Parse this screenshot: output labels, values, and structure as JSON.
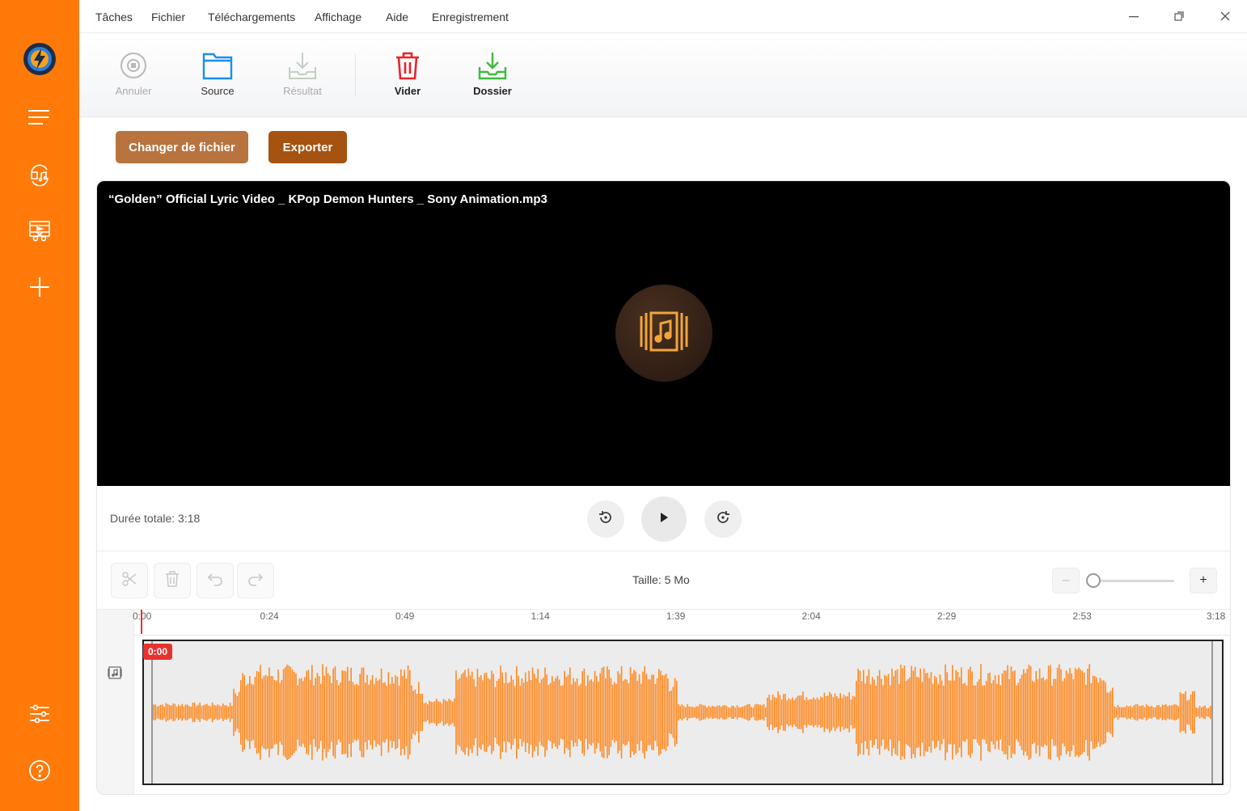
{
  "colors": {
    "accent": "#ff7a09",
    "change_button": "#b8733e",
    "export_button": "#a65210",
    "waveform": "#ff8a22",
    "playhead": "#e8322d"
  },
  "sidebar": {
    "items": [
      {
        "icon": "app-logo-icon"
      },
      {
        "icon": "menu-icon"
      },
      {
        "icon": "audio-convert-icon"
      },
      {
        "icon": "video-cut-icon"
      },
      {
        "icon": "add-icon"
      },
      {
        "icon": "settings-sliders-icon"
      },
      {
        "icon": "help-icon"
      }
    ]
  },
  "menu": {
    "items": [
      "Tâches",
      "Fichier",
      "Téléchargements",
      "Affichage",
      "Aide",
      "Enregistrement"
    ]
  },
  "toolbar": {
    "cancel_label": "Annuler",
    "source_label": "Source",
    "result_label": "Résultat",
    "clear_label": "Vider",
    "folder_label": "Dossier"
  },
  "actions": {
    "change_file_label": "Changer de fichier",
    "export_label": "Exporter"
  },
  "player": {
    "file_title": "“Golden” Official Lyric Video _ KPop Demon Hunters _ Sony Animation.mp3",
    "duration_text": "Durée totale: 3:18",
    "size_text": "Taille: 5 Mo",
    "zoom_level": 0.0
  },
  "timeline": {
    "ticks": [
      "0:00",
      "0:24",
      "0:49",
      "1:14",
      "1:39",
      "2:04",
      "2:29",
      "2:53",
      "3:18"
    ],
    "current_time": "0:00"
  }
}
